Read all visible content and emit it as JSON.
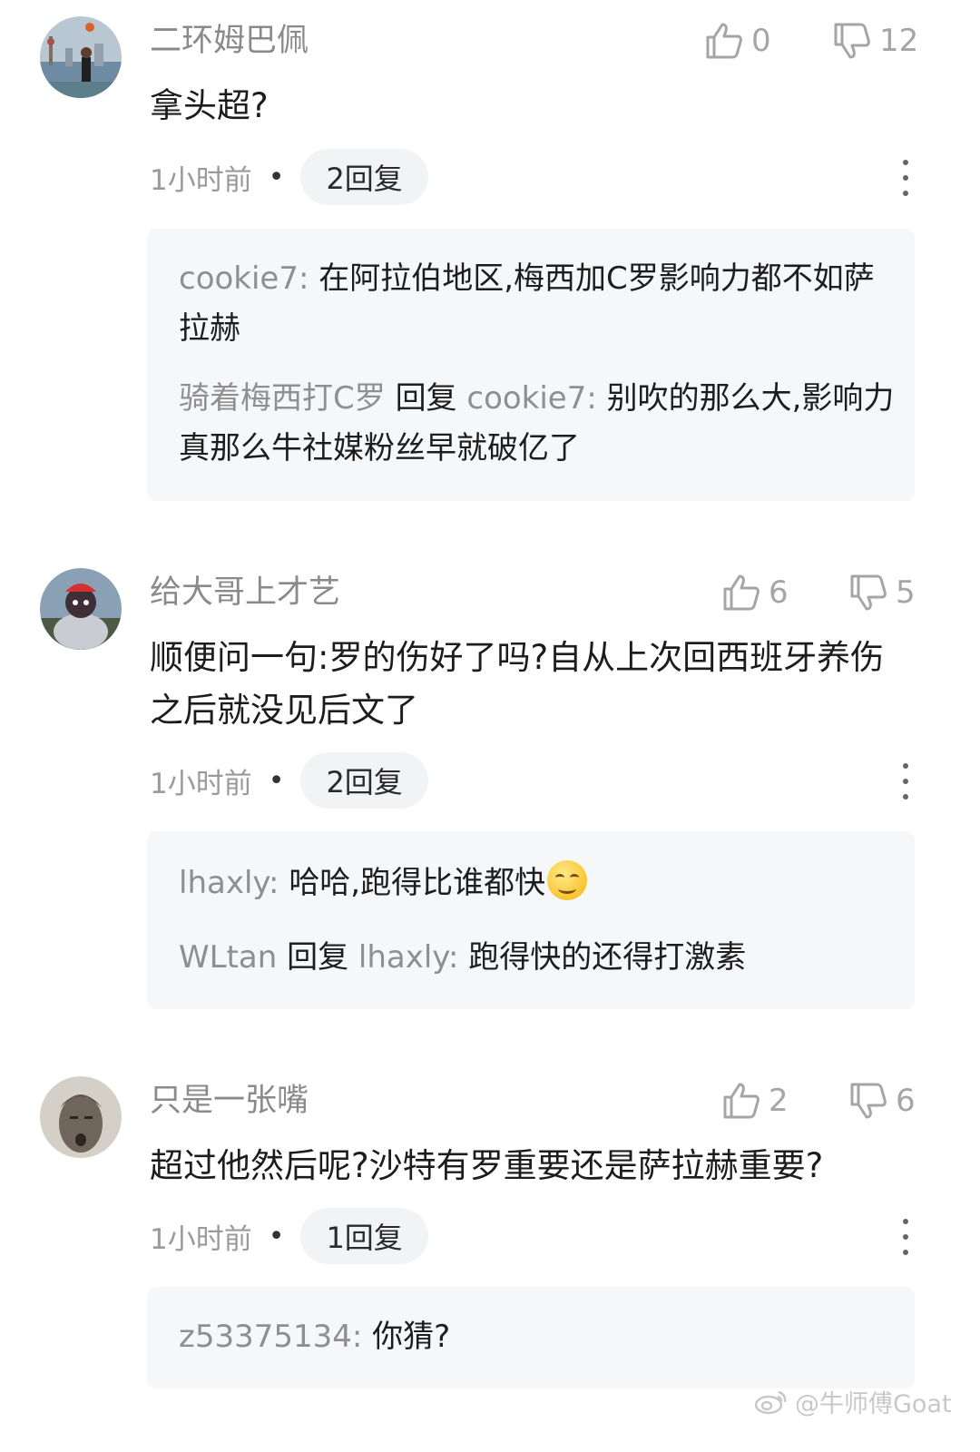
{
  "comments": [
    {
      "username": "二环姆巴佩",
      "likes": "0",
      "dislikes": "12",
      "content": "拿头超?",
      "time": "1小时前",
      "reply_count": "2回复",
      "replies": [
        {
          "name": "cookie7:",
          "reply_word": "",
          "target": "",
          "text": "在阿拉伯地区,梅西加C罗影响力都不如萨拉赫"
        },
        {
          "name": "骑着梅西打C罗",
          "reply_word": "回复",
          "target": "cookie7:",
          "text": "别吹的那么大,影响力真那么牛社媒粉丝早就破亿了"
        }
      ]
    },
    {
      "username": "给大哥上才艺",
      "likes": "6",
      "dislikes": "5",
      "content": "顺便问一句:罗的伤好了吗?自从上次回西班牙养伤之后就没见后文了",
      "time": "1小时前",
      "reply_count": "2回复",
      "replies": [
        {
          "name": "lhaxly:",
          "reply_word": "",
          "target": "",
          "text": "哈哈,跑得比谁都快"
        },
        {
          "name": "WLtan",
          "reply_word": "回复",
          "target": "lhaxly:",
          "text": "跑得快的还得打激素"
        }
      ]
    },
    {
      "username": "只是一张嘴",
      "likes": "2",
      "dislikes": "6",
      "content": "超过他然后呢?沙特有罗重要还是萨拉赫重要?",
      "time": "1小时前",
      "reply_count": "1回复",
      "replies": [
        {
          "name": "z53375134:",
          "reply_word": "",
          "target": "",
          "text": "你猜?"
        }
      ]
    }
  ],
  "watermark": "@牛师傅Goat",
  "icons": {
    "like": "thumbs-up-icon",
    "dislike": "thumbs-down-icon",
    "more": "more-vertical-icon",
    "emoji": "smile-emoji-icon",
    "watermark": "weibo-logo-icon"
  }
}
